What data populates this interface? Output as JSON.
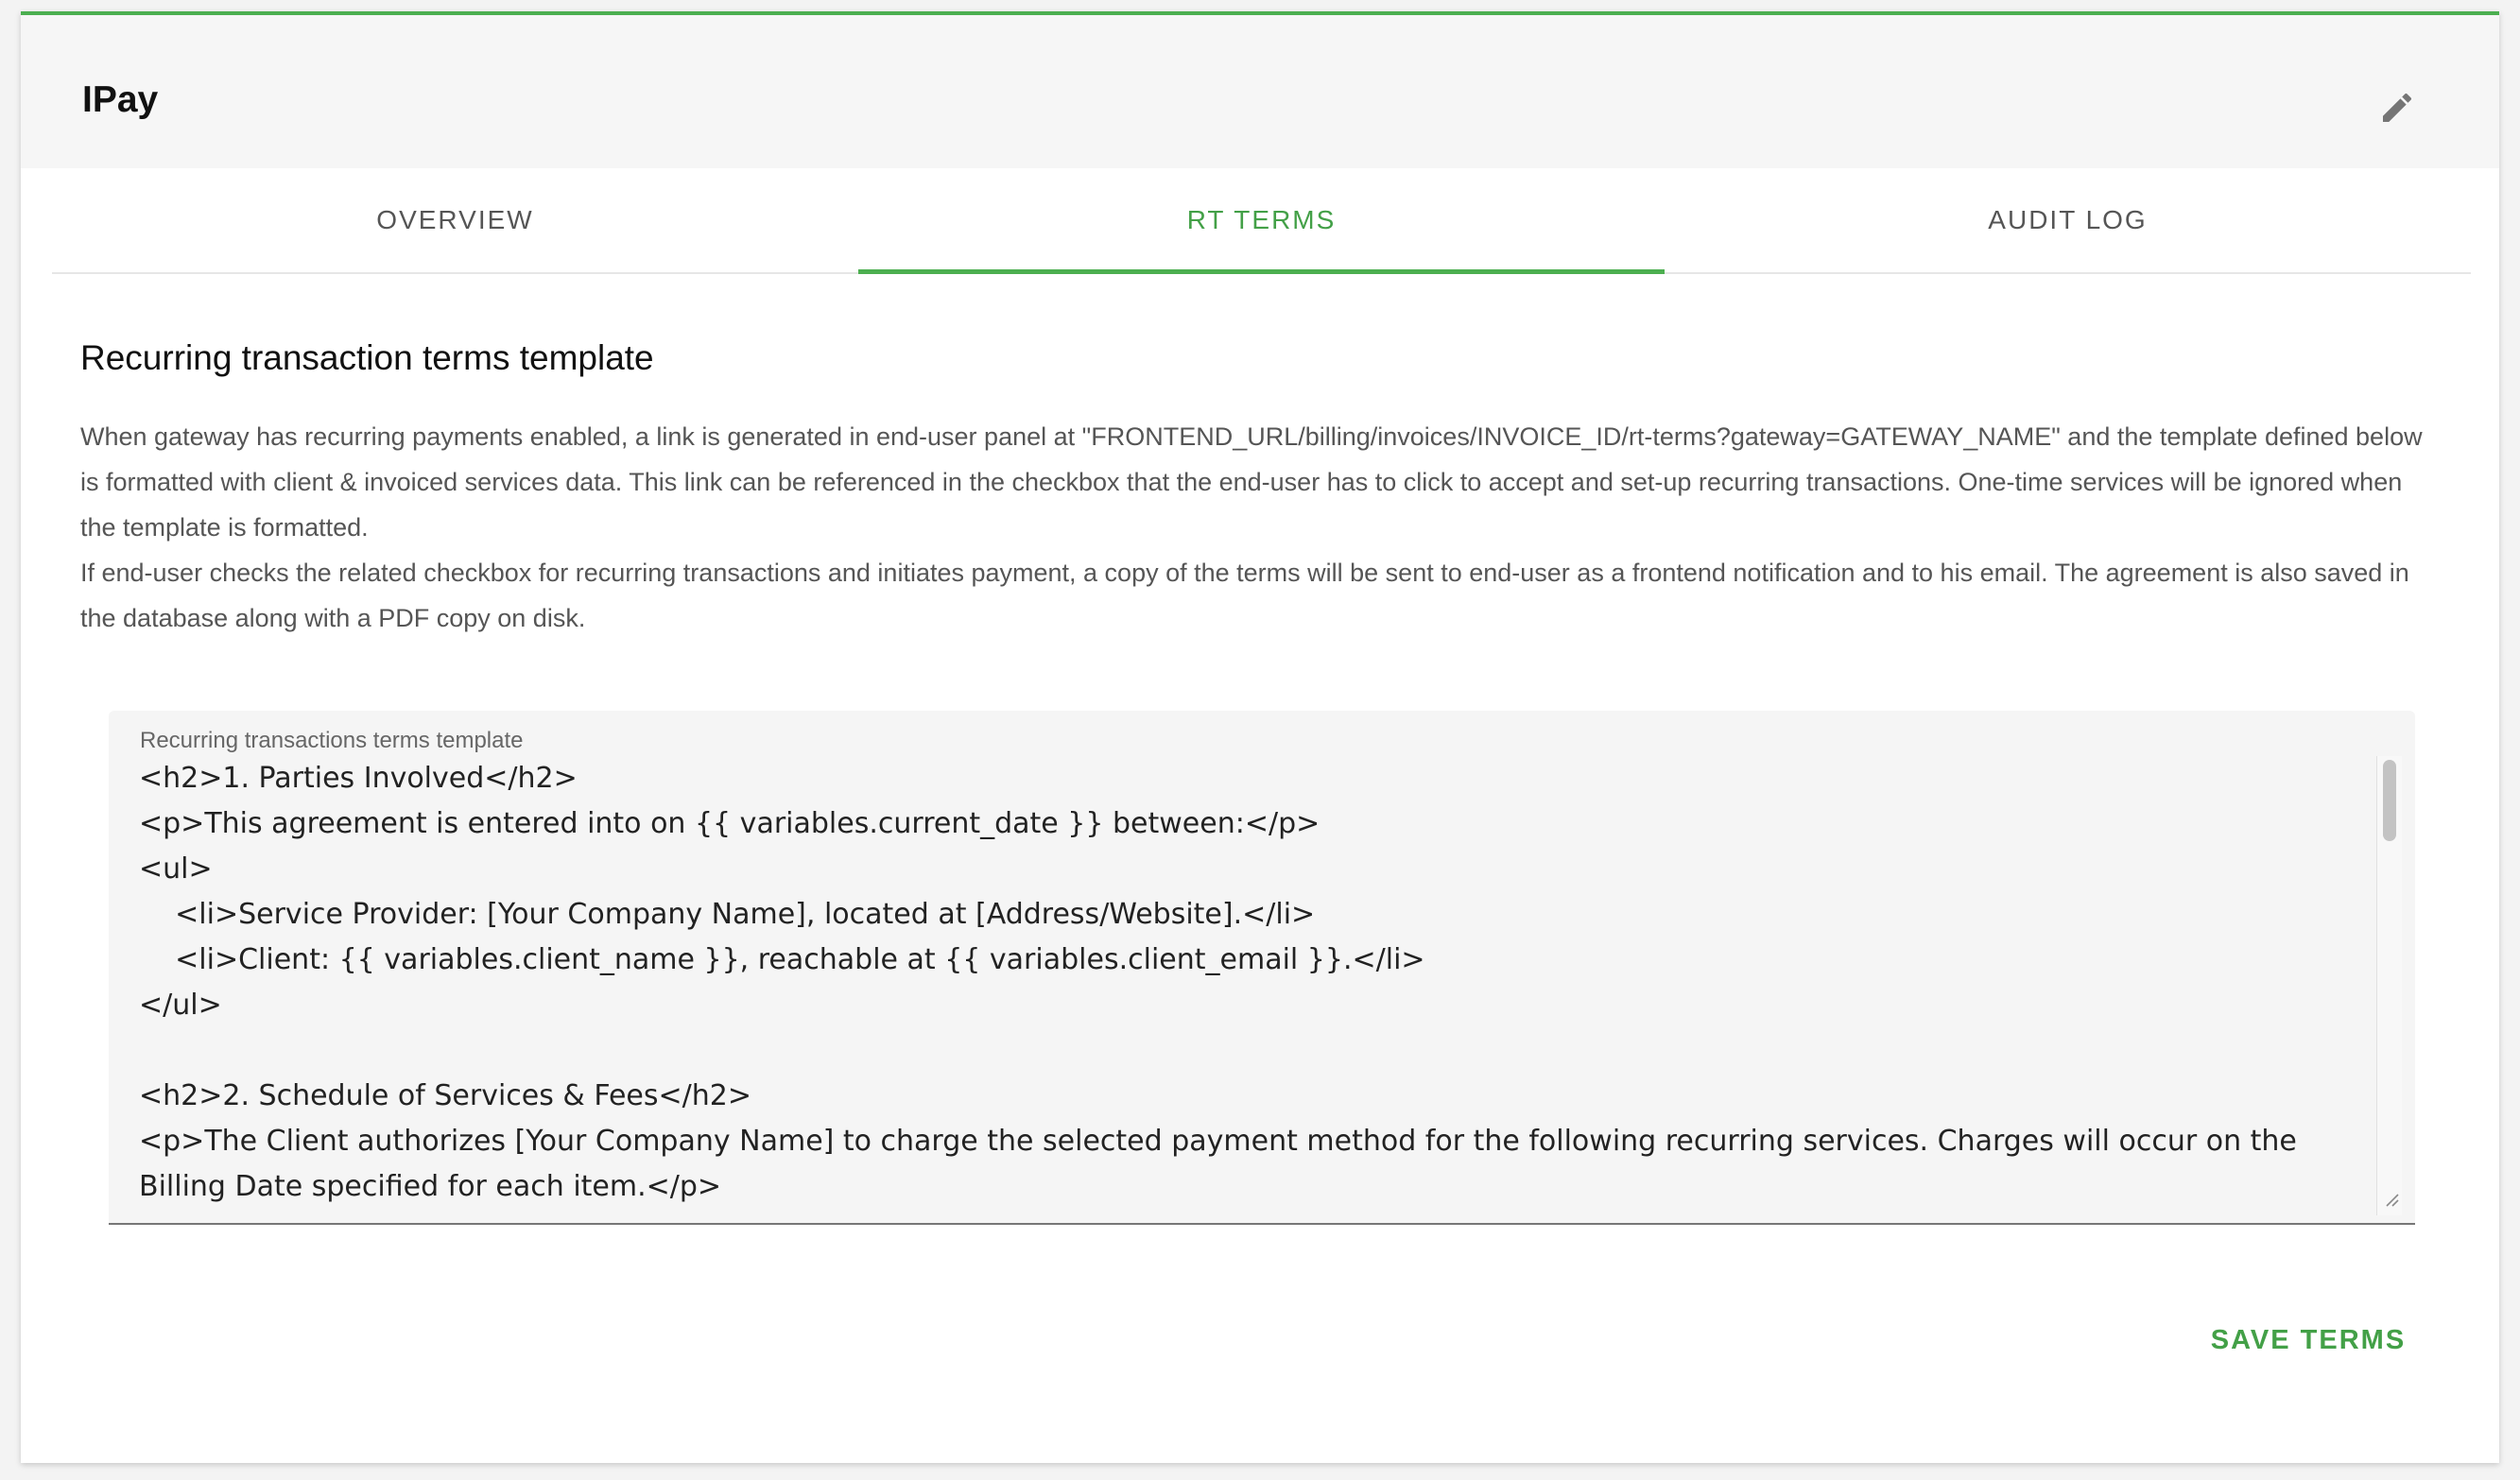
{
  "header": {
    "title": "IPay",
    "edit_icon": "pencil-icon"
  },
  "tabs": [
    {
      "label": "OVERVIEW",
      "active": false
    },
    {
      "label": "RT TERMS",
      "active": true
    },
    {
      "label": "AUDIT LOG",
      "active": false
    }
  ],
  "colors": {
    "accent": "#4caf50",
    "header_bg": "#f6f6f6"
  },
  "section": {
    "title": "Recurring transaction terms template",
    "description_1": "When gateway has recurring payments enabled, a link is generated in end-user panel at \"FRONTEND_URL/billing/invoices/INVOICE_ID/rt-terms?gateway=GATEWAY_NAME\" and the template defined below is formatted with client & invoiced services data. This link can be referenced in the checkbox that the end-user has to click to accept and set-up recurring transactions. One-time services will be ignored when the template is formatted.",
    "description_2": "If end-user checks the related checkbox for recurring transactions and initiates payment, a copy of the terms will be sent to end-user as a frontend notification and to his email. The agreement is also saved in the database along with a PDF copy on disk."
  },
  "template_field": {
    "label": "Recurring transactions terms template",
    "value": "<h2>1. Parties Involved</h2>\n<p>This agreement is entered into on {{ variables.current_date }} between:</p>\n<ul>\n    <li>Service Provider: [Your Company Name], located at [Address/Website].</li>\n    <li>Client: {{ variables.client_name }}, reachable at {{ variables.client_email }}.</li>\n</ul>\n\n<h2>2. Schedule of Services & Fees</h2>\n<p>The Client authorizes [Your Company Name] to charge the selected payment method for the following recurring services. Charges will occur on the Billing Date specified for each item.</p>"
  },
  "actions": {
    "save_label": "SAVE TERMS"
  }
}
